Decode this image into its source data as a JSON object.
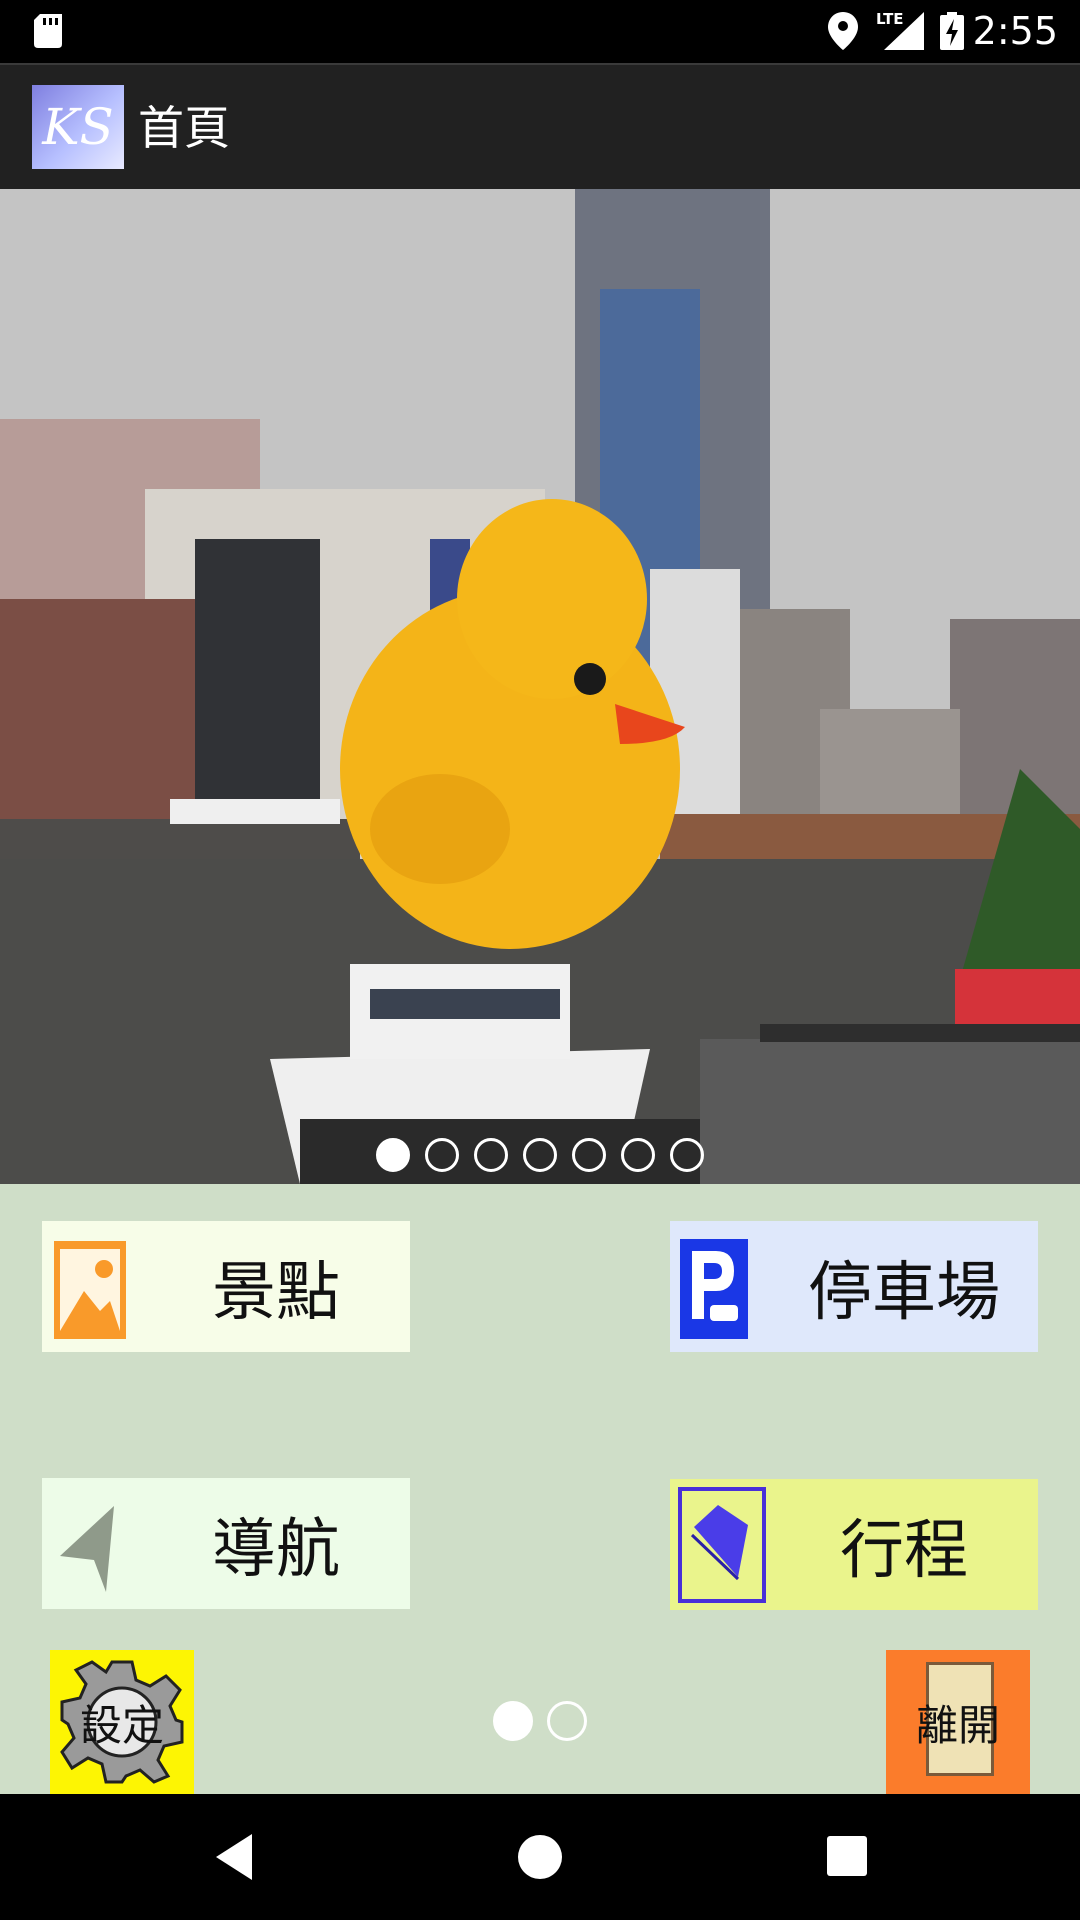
{
  "status_bar": {
    "time": "2:55",
    "network": "LTE",
    "icons": [
      "sd-card-icon",
      "location-icon",
      "signal-icon",
      "battery-charging-icon"
    ]
  },
  "app_bar": {
    "logo_text": "KS",
    "title": "首頁"
  },
  "hero": {
    "image_pages": 7,
    "active_page": 0
  },
  "menu": {
    "spots": {
      "label": "景點",
      "icon": "scenery-icon",
      "color": "#f7fde8"
    },
    "parking": {
      "label": "停車場",
      "icon": "parking-icon",
      "color": "#dfe8fb"
    },
    "navigation": {
      "label": "導航",
      "icon": "navigation-arrow-icon",
      "color": "#edfce8"
    },
    "itinerary": {
      "label": "行程",
      "icon": "notebook-icon",
      "color": "#eaf48c"
    }
  },
  "bottom": {
    "settings_label": "設定",
    "exit_label": "離開",
    "pages": 2,
    "active_page": 0
  },
  "colors": {
    "background": "#cfdec8",
    "settings_bg": "#fdf503",
    "exit_bg": "#fb7c2b",
    "app_bar": "#212121"
  },
  "nav_bar": {
    "icons": [
      "back-icon",
      "home-icon",
      "recents-icon"
    ]
  }
}
